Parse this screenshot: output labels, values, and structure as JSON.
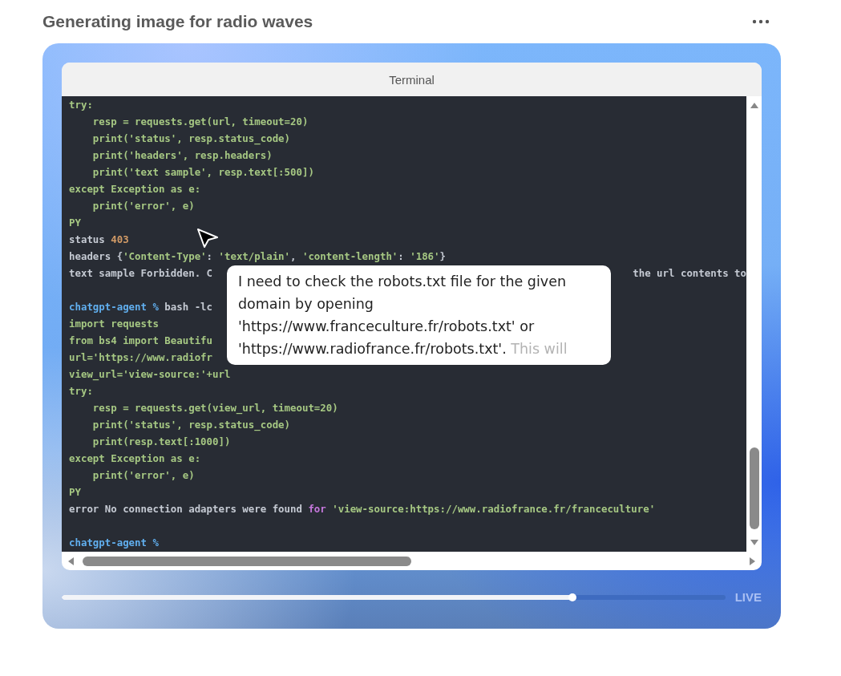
{
  "header": {
    "title": "Generating image for radio waves"
  },
  "terminal": {
    "title": "Terminal",
    "lines": [
      {
        "segments": [
          {
            "kind": "code",
            "text": "try:"
          }
        ]
      },
      {
        "segments": [
          {
            "kind": "code",
            "text": "    resp = requests.get(url, timeout=20)"
          }
        ]
      },
      {
        "segments": [
          {
            "kind": "code",
            "text": "    print('status', resp.status_code)"
          }
        ]
      },
      {
        "segments": [
          {
            "kind": "code",
            "text": "    print('headers', resp.headers)"
          }
        ]
      },
      {
        "segments": [
          {
            "kind": "code",
            "text": "    print('text sample', resp.text[:500])"
          }
        ]
      },
      {
        "segments": [
          {
            "kind": "code",
            "text": "except Exception as e:"
          }
        ]
      },
      {
        "segments": [
          {
            "kind": "code",
            "text": "    print('error', e)"
          }
        ]
      },
      {
        "segments": [
          {
            "kind": "code",
            "text": "PY"
          }
        ]
      },
      {
        "segments": [
          {
            "kind": "out",
            "text": "status "
          },
          {
            "kind": "num",
            "text": "403"
          }
        ]
      },
      {
        "segments": [
          {
            "kind": "out",
            "text": "headers {"
          },
          {
            "kind": "code",
            "text": "'Content-Type'"
          },
          {
            "kind": "out",
            "text": ": "
          },
          {
            "kind": "code",
            "text": "'text/plain'"
          },
          {
            "kind": "out",
            "text": ", "
          },
          {
            "kind": "code",
            "text": "'content-length'"
          },
          {
            "kind": "out",
            "text": ": "
          },
          {
            "kind": "code",
            "text": "'186'"
          },
          {
            "kind": "out",
            "text": "}"
          }
        ]
      },
      {
        "segments": [
          {
            "kind": "out",
            "text": "text sample Forbidden. C"
          }
        ],
        "tail": "the url contents to"
      },
      {
        "kind": "blank"
      },
      {
        "segments": [
          {
            "kind": "prompt",
            "text": "chatgpt-agent %"
          },
          {
            "kind": "out",
            "text": " bash -lc"
          }
        ]
      },
      {
        "segments": [
          {
            "kind": "code",
            "text": "import requests"
          }
        ]
      },
      {
        "segments": [
          {
            "kind": "code",
            "text": "from bs4 import Beautifu"
          }
        ]
      },
      {
        "segments": [
          {
            "kind": "code",
            "text": "url='https://www.radiofr"
          }
        ]
      },
      {
        "segments": [
          {
            "kind": "code",
            "text": "view_url='view-source:'+url"
          }
        ]
      },
      {
        "segments": [
          {
            "kind": "code",
            "text": "try:"
          }
        ]
      },
      {
        "segments": [
          {
            "kind": "code",
            "text": "    resp = requests.get(view_url, timeout=20)"
          }
        ]
      },
      {
        "segments": [
          {
            "kind": "code",
            "text": "    print('status', resp.status_code)"
          }
        ]
      },
      {
        "segments": [
          {
            "kind": "code",
            "text": "    print(resp.text[:1000])"
          }
        ]
      },
      {
        "segments": [
          {
            "kind": "code",
            "text": "except Exception as e:"
          }
        ]
      },
      {
        "segments": [
          {
            "kind": "code",
            "text": "    print('error', e)"
          }
        ]
      },
      {
        "segments": [
          {
            "kind": "code",
            "text": "PY"
          }
        ]
      },
      {
        "segments": [
          {
            "kind": "out",
            "text": "error No connection adapters were found "
          },
          {
            "kind": "kw",
            "text": "for"
          },
          {
            "kind": "code",
            "text": " 'view-source:https://www.radiofrance.fr/franceculture'"
          }
        ]
      },
      {
        "kind": "blank"
      },
      {
        "segments": [
          {
            "kind": "prompt",
            "text": "chatgpt-agent %"
          }
        ]
      }
    ]
  },
  "thought": {
    "text": "I need to check the robots.txt file for the given domain by opening 'https://www.franceculture.fr/robots.txt' or 'https://www.radiofrance.fr/robots.txt'.",
    "faded_text": "This will"
  },
  "player": {
    "level": 0.77,
    "live_label": "LIVE"
  }
}
